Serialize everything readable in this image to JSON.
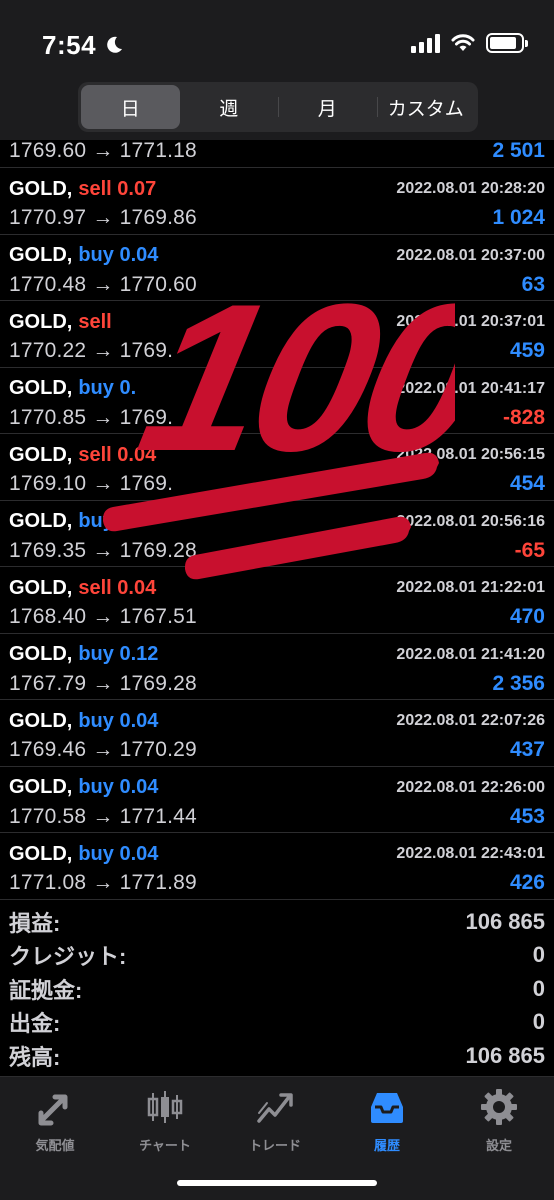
{
  "status_bar": {
    "time": "7:54"
  },
  "period_tabs": [
    {
      "label": "日",
      "active": true
    },
    {
      "label": "週",
      "active": false
    },
    {
      "label": "月",
      "active": false
    },
    {
      "label": "カスタム",
      "active": false
    }
  ],
  "partial_row": {
    "prices": "1769.60 → 1771.18",
    "profit": "2 501"
  },
  "trades": [
    {
      "symbol": "GOLD,",
      "side": "sell 0.07",
      "datetime": "2022.08.01 20:28:20",
      "prices": "1770.97 → 1769.86",
      "profit": "1 024"
    },
    {
      "symbol": "GOLD,",
      "side": "buy 0.04",
      "datetime": "2022.08.01 20:37:00",
      "prices": "1770.48 → 1770.60",
      "profit": "63"
    },
    {
      "symbol": "GOLD,",
      "side": "sell",
      "datetime": "2022.08.01 20:37:01",
      "prices": "1770.22 → 1769.",
      "profit": "459"
    },
    {
      "symbol": "GOLD,",
      "side": "buy 0.",
      "datetime": "2022.08.01 20:41:17",
      "prices": "1770.85 → 1769.",
      "profit": "-828"
    },
    {
      "symbol": "GOLD,",
      "side": "sell 0.04",
      "datetime": "2022.08.01 20:56:15",
      "prices": "1769.10 → 1769.",
      "profit": "454"
    },
    {
      "symbol": "GOLD,",
      "side": "buy",
      "datetime": "2022.08.01 20:56:16",
      "prices": "1769.35 → 1769.28",
      "profit": "-65"
    },
    {
      "symbol": "GOLD,",
      "side": "sell 0.04",
      "datetime": "2022.08.01 21:22:01",
      "prices": "1768.40 → 1767.51",
      "profit": "470"
    },
    {
      "symbol": "GOLD,",
      "side": "buy 0.12",
      "datetime": "2022.08.01 21:41:20",
      "prices": "1767.79 → 1769.28",
      "profit": "2 356"
    },
    {
      "symbol": "GOLD,",
      "side": "buy 0.04",
      "datetime": "2022.08.01 22:07:26",
      "prices": "1769.46 → 1770.29",
      "profit": "437"
    },
    {
      "symbol": "GOLD,",
      "side": "buy 0.04",
      "datetime": "2022.08.01 22:26:00",
      "prices": "1770.58 → 1771.44",
      "profit": "453"
    },
    {
      "symbol": "GOLD,",
      "side": "buy 0.04",
      "datetime": "2022.08.01 22:43:01",
      "prices": "1771.08 → 1771.89",
      "profit": "426"
    }
  ],
  "summary": {
    "pl_label": "損益:",
    "pl_value": "106 865",
    "credit_label": "クレジット:",
    "credit_value": "0",
    "deposit_label": "証拠金:",
    "deposit_value": "0",
    "withdrawal_label": "出金:",
    "withdrawal_value": "0",
    "balance_label": "残高:",
    "balance_value": "106 865"
  },
  "tabbar": [
    {
      "label": "気配値",
      "icon": "quotes-arrows-icon",
      "active": false
    },
    {
      "label": "チャート",
      "icon": "candlestick-chart-icon",
      "active": false
    },
    {
      "label": "トレード",
      "icon": "trade-trend-icon",
      "active": false
    },
    {
      "label": "履歴",
      "icon": "history-tray-icon",
      "active": true
    },
    {
      "label": "設定",
      "icon": "settings-gear-icon",
      "active": false
    }
  ],
  "sticker": {
    "text": "100",
    "icon": "hundred-points-emoji"
  },
  "colors": {
    "sell": "#ff453a",
    "buy": "#2f8cff",
    "sticker": "#c8102e"
  }
}
